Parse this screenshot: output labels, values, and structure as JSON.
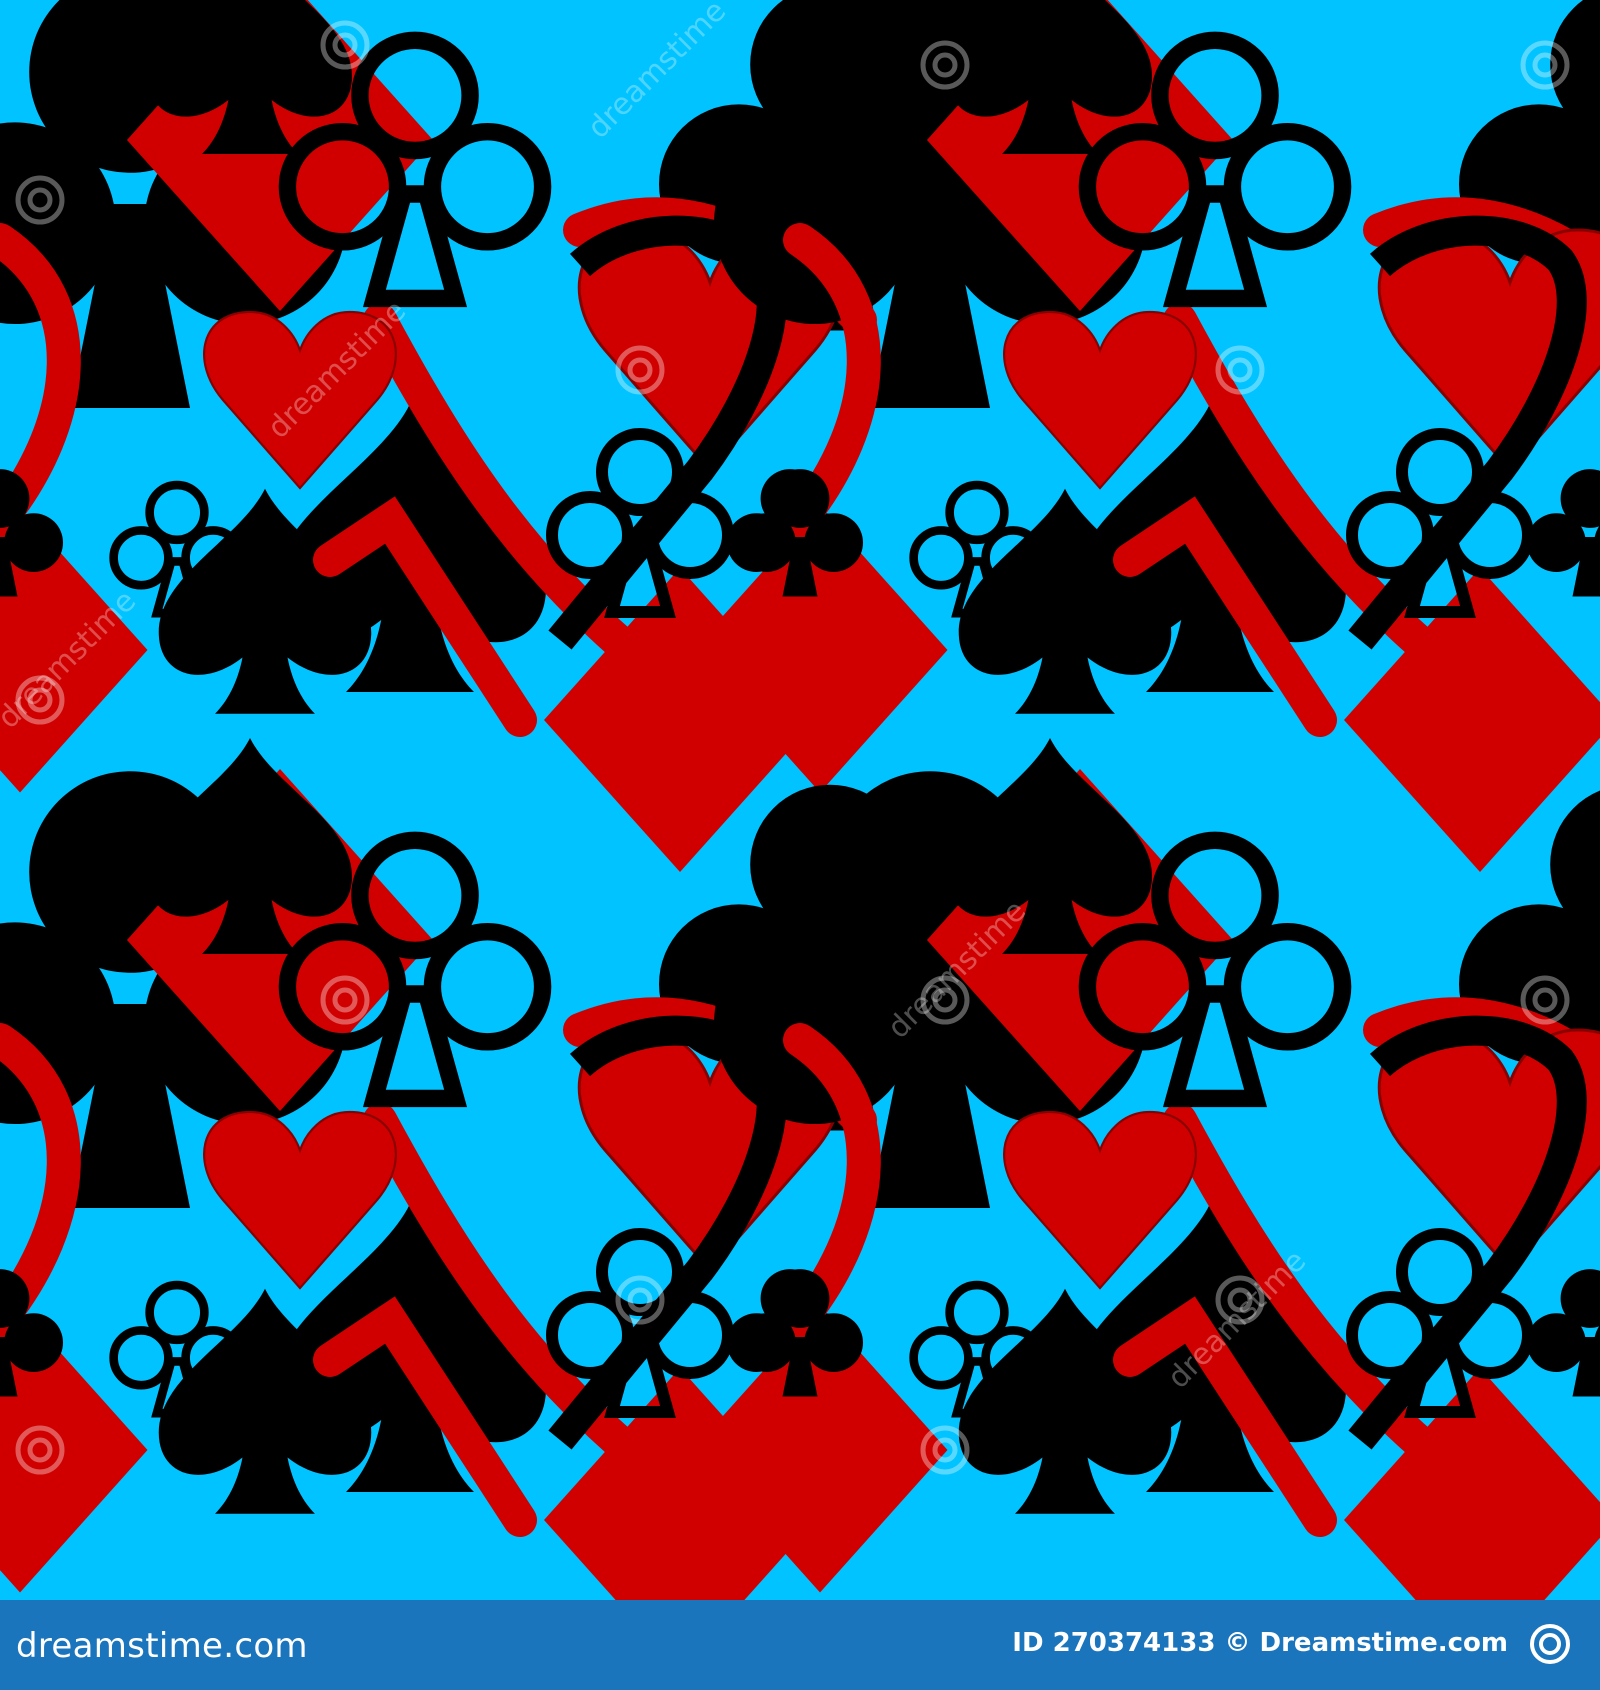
{
  "image": {
    "subject": "seamless card-suit pattern",
    "colors": {
      "background": "#00c3ff",
      "red": "#d10000",
      "black": "#000000",
      "footer": "#1b75bc"
    },
    "watermark_text": "dreamstime"
  },
  "footer": {
    "site": "dreamstime.com",
    "id": "ID 270374133 © Dreamstime.com"
  }
}
